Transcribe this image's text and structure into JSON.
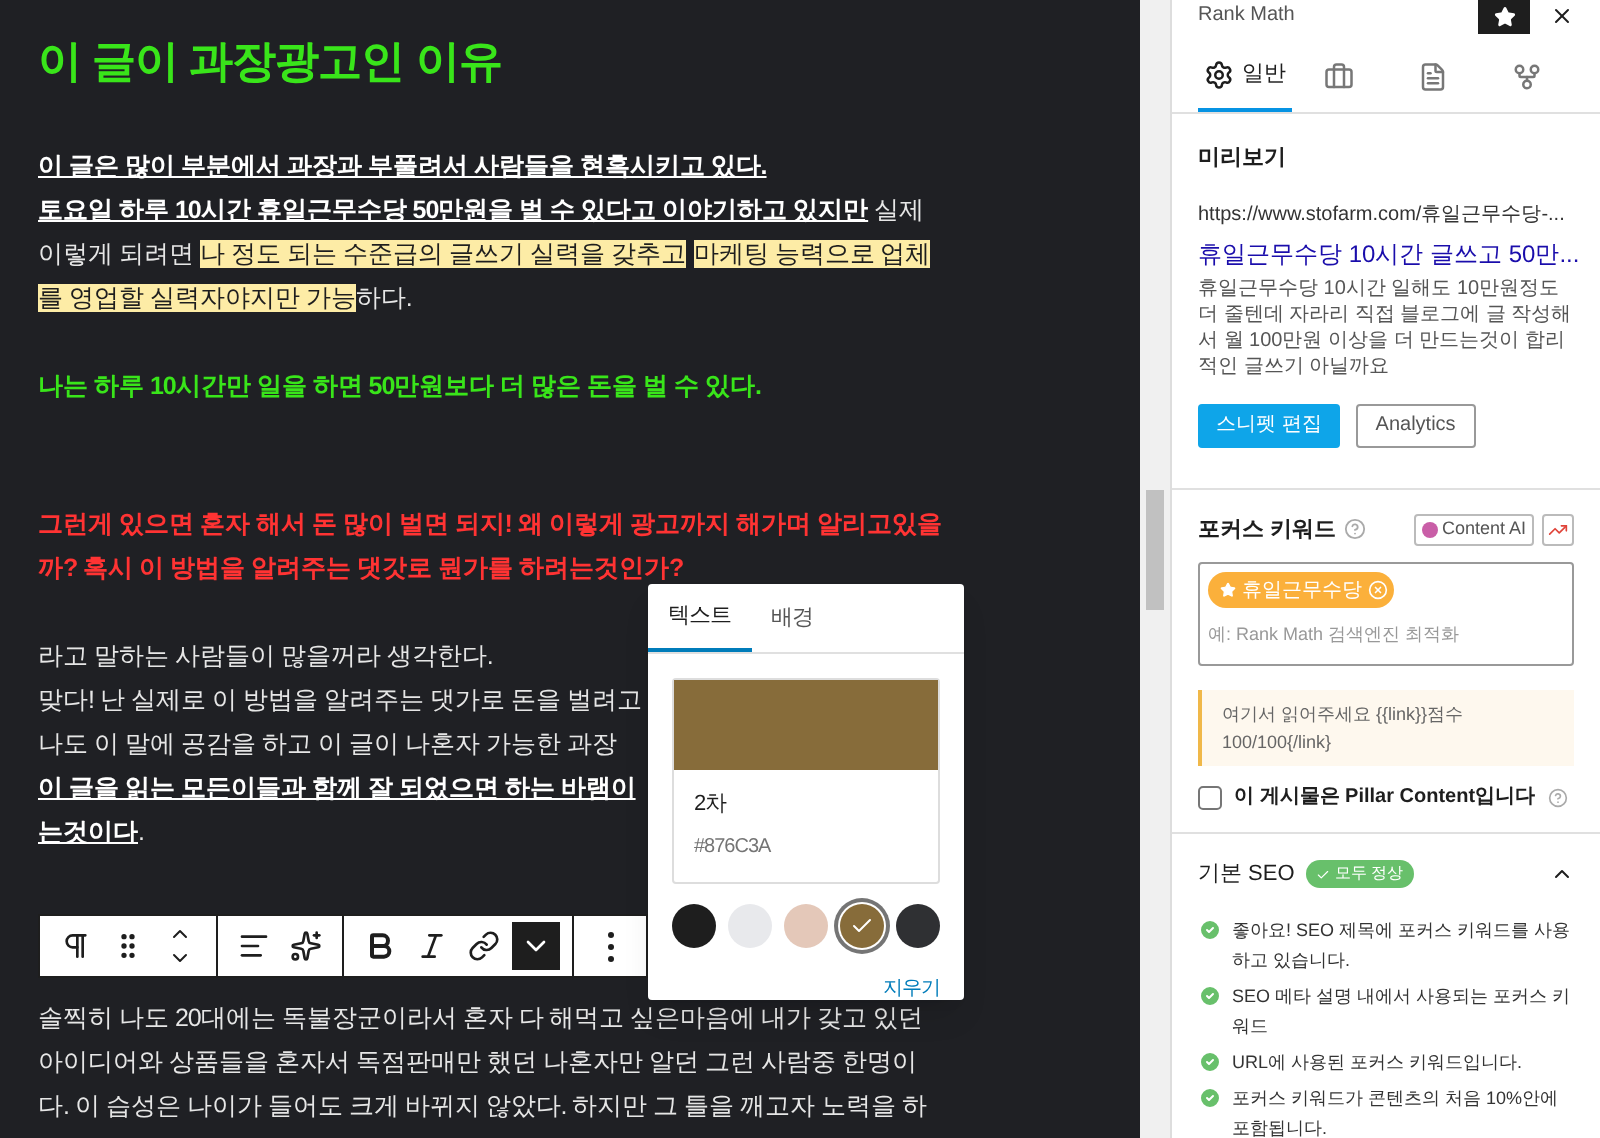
{
  "editor": {
    "title": "이 글이 과장광고인 이유",
    "paragraphs": [
      {
        "kind": "normal",
        "lines": [
          [
            {
              "text": "이 글은 많이 부분에서 과장과 부풀려서 사람들을 현혹시키고 있다.",
              "kind": "underline"
            }
          ],
          [
            {
              "text": "토요일 하루 10시간 휴일근무수당 50만원을 벌 수 있다고 이야기하고 있지만",
              "kind": "underline"
            },
            {
              "text": " 실제",
              "kind": "plain"
            }
          ],
          [
            {
              "text": "이렇게 되려면 ",
              "kind": "plain"
            },
            {
              "text": "나 정도 되는 수준급의 글쓰기 실력을 갖추고",
              "kind": "highlight"
            },
            {
              "text": "마케팅 능력으로 업체",
              "kind": "highlight"
            }
          ],
          [
            {
              "text": "를 영업할 실력자야지만 가능",
              "kind": "highlight"
            },
            {
              "text": "하다.",
              "kind": "plain"
            }
          ]
        ]
      },
      {
        "kind": "green",
        "lines": [
          [
            {
              "text": "나는 하루 10시간만 일을 하면 50만원보다 더 많은 돈을 벌 수 있다.",
              "kind": "plain"
            }
          ]
        ]
      },
      {
        "kind": "red",
        "lines": [
          [
            {
              "text": "그런게 있으면 혼자 해서 돈 많이 벌면 되지! 왜 이렇게 광고까지 해가며 알리고있을",
              "kind": "plain"
            }
          ],
          [
            {
              "text": "까? 혹시 이 방법을 알려주는 댓갓로 뭔가를 하려는것인가?",
              "kind": "plain"
            }
          ]
        ]
      },
      {
        "kind": "normal",
        "lines": [
          [
            {
              "text": "라고 말하는 사람들이 많을꺼라 생각한다.",
              "kind": "plain"
            }
          ],
          [
            {
              "text": "맞다! 난 실제로 이 방법을 알려주는 댓가로 돈을 벌려고",
              "kind": "plain"
            }
          ],
          [
            {
              "text": "나도 이 말에 공감을 하고 이 글이 나혼자 가능한 과장",
              "kind": "plain"
            }
          ],
          [
            {
              "text": "이 글을 읽는 모든이들과 함께 잘 되었으면 하는 바램이",
              "kind": "underline"
            }
          ],
          [
            {
              "text": "는것이다",
              "kind": "underline"
            },
            {
              "text": ".",
              "kind": "plain"
            }
          ]
        ]
      }
    ],
    "toolbar": [
      [
        {
          "kind": "paragraph",
          "pressed": false
        },
        {
          "kind": "drag",
          "pressed": false
        },
        {
          "kind": "move",
          "pressed": false
        }
      ],
      [
        {
          "kind": "align",
          "pressed": false
        },
        {
          "kind": "sparkle",
          "pressed": false
        }
      ],
      [
        {
          "kind": "bold",
          "pressed": false
        },
        {
          "kind": "italic",
          "pressed": false
        },
        {
          "kind": "link",
          "pressed": false
        },
        {
          "kind": "more-rich",
          "pressed": true
        }
      ],
      [
        {
          "kind": "options",
          "pressed": false
        }
      ]
    ],
    "after_toolbar": {
      "lines": [
        "솔찍히 나도 20대에는 독불장군이라서 혼자 다 해먹고 싶은마음에 내가 갖고 있던",
        "아이디어와 상품들을 혼자서 독점판매만 했던 나혼자만 알던 그런 사람중 한명이",
        "다. 이 습성은 나이가 들어도 크게 바뀌지 않았다. 하지만 그 틀을 깨고자 노력을 하"
      ]
    }
  },
  "color_popover": {
    "tabs": [
      {
        "label": "텍스트",
        "selected": true
      },
      {
        "label": "배경",
        "selected": false
      }
    ],
    "current": {
      "color": "#876c3a",
      "name": "2차",
      "hex": "#876C3A"
    },
    "swatches": [
      {
        "color": "#1e1e1e",
        "selected": false
      },
      {
        "color": "#e8e9ec",
        "selected": false
      },
      {
        "color": "#e4c8b9",
        "selected": false
      },
      {
        "color": "#876c3a",
        "selected": true
      },
      {
        "color": "#2f3033",
        "selected": false
      }
    ],
    "clear": "지우기"
  },
  "sidebar": {
    "title": "Rank Math",
    "tabs": [
      {
        "kind": "gear",
        "label": "일반",
        "selected": true
      },
      {
        "kind": "briefcase",
        "selected": false
      },
      {
        "kind": "document",
        "selected": false
      },
      {
        "kind": "nodes",
        "selected": false
      }
    ],
    "preview": {
      "heading": "미리보기",
      "url": "https://www.stofarm.com/휴일근무수당-...",
      "title": "휴일근무수당 10시간 글쓰고 50만...",
      "description": "휴일근무수당 10시간 일해도 10만원정도 더 줄텐데 자라리 직접 블로그에 글 작성해서 월 100만원 이상을 더 만드는것이 합리적인 글쓰기 아닐까요",
      "buttons": [
        {
          "label": "스니펫 편집",
          "kind": "primary"
        },
        {
          "label": "Analytics",
          "kind": "secondary"
        }
      ]
    },
    "focus_keyword": {
      "label": "포커스 키워드",
      "content_ai": "Content AI",
      "keywords": [
        "휴일근무수당"
      ],
      "placeholder": "예: Rank Math 검색엔진 최적화"
    },
    "notice": "여기서 읽어주세요 {{link}}점수 100/100{/link}",
    "pillar": {
      "label": "이 게시물은 Pillar Content입니다",
      "checked": false
    },
    "basic_seo": {
      "title": "기본 SEO",
      "badge": "모두 정상",
      "expanded": true,
      "checks": [
        {
          "text": "좋아요! SEO 제목에 포커스 키워드를 사용하고 있습니다.",
          "passed": true
        },
        {
          "text": "SEO 메타 설명 내에서 사용되는 포커스 키워드",
          "passed": true
        },
        {
          "text": "URL에 사용된 포커스 키워드입니다.",
          "passed": true
        },
        {
          "text": "포커스 키워드가 콘텐츠의 처음 10%안에 포함됩니다.",
          "passed": true
        }
      ]
    }
  }
}
